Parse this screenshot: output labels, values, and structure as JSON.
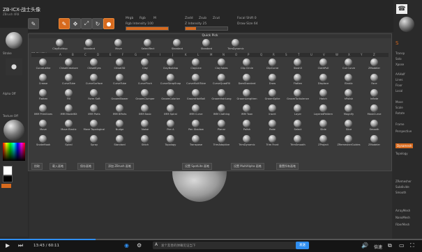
{
  "app": {
    "title": "ZB-ICX-战士头像",
    "subtitle": "ZBrush 4R8"
  },
  "top": {
    "labels": [
      "Mrgb",
      "Rgb",
      "M",
      "Zadd",
      "Zsub",
      "Zcut",
      "Rgb Intensity 100",
      "Z Intensity 25",
      "Focal Shift 0",
      "Draw Size 64"
    ],
    "rgb_intensity": 100,
    "z_intensity": 25
  },
  "quickpick": {
    "title": "Quick Pick",
    "items": [
      "ClayBuildup",
      "Standard",
      "Move",
      "SelectRect",
      "Standard",
      "Standard",
      "TrimDynamic"
    ]
  },
  "brush_section": {
    "title": "3D 雕刻画笔",
    "alphabet": [
      "A",
      "B",
      "C",
      "D",
      "E",
      "F",
      "G",
      "H",
      "I",
      "J",
      "K",
      "L",
      "M",
      "N",
      "O",
      "P",
      "Q",
      "R",
      "S",
      "T",
      "U",
      "V",
      "W",
      "X",
      "Y",
      "Z"
    ]
  },
  "brushes": [
    [
      "CurveLathe",
      "ChiselCreature",
      "ChiselEyes",
      "Chisel3D",
      "Clay",
      "ClayBuildup",
      "ClayLine",
      "ClayTubes",
      "Clip Circle",
      "ClipCurve",
      "Slash3",
      "ClothPull",
      "Cut Curve",
      "ZModeler"
    ],
    [
      "Crease",
      "CurveTube",
      "CurveSurface",
      "CurveTube",
      "CurvePinch",
      "CurveStrapSnap",
      "CurveMultiTube",
      "CurveQuadFill",
      "DamStandard",
      "Draw",
      "Flatten",
      "Displace",
      "Elastic",
      "Face"
    ],
    [
      "Flatten",
      "Fill",
      "Form Soft",
      "GroomBlower",
      "GroomClumper",
      "GroomColorize",
      "GroomHairBall",
      "GroomHairLong",
      "GroomLengthen",
      "GroomSpike",
      "GroomTurbulence",
      "Hatch",
      "hPolish",
      "Inflate"
    ],
    [
      "IMM Primitives",
      "IMM ModelKit",
      "IMM Parts",
      "IMM BParts",
      "IMM Basic",
      "IMM Spiral",
      "IMM Curve",
      "IMM Clothing",
      "IMM Toon",
      "Insert",
      "Layer",
      "LayeredPattern",
      "Magnify",
      "MaskCurve"
    ],
    [
      "Move",
      "Move Elastic",
      "Move Topological",
      "Nudge",
      "Noise",
      "Pen A",
      "Pen Shadow",
      "Planar",
      "Polish",
      "Rake",
      "Select",
      "Slide",
      "Slice",
      "Smooth"
    ],
    [
      "SnakeHook",
      "Spiral",
      "Spray",
      "Standard",
      "Stitch",
      "Topology",
      "Transpose",
      "TrimAdaptive",
      "TrimDynamic",
      "Trim Front",
      "TrimSmooth",
      "ZProject",
      "ZRemesherGuides",
      "ZModeler"
    ]
  ],
  "bottom_buttons": [
    "拾取",
    "载入画笔",
    "保存画笔",
    "添加 ZBrush 画笔",
    "设置 SpotLite 画笔",
    "设置 MultiAlpha 画笔",
    "重置所有画笔"
  ],
  "left_panel": [
    "Stroke",
    "Alpha Off",
    "Texture Off",
    "Material",
    "Gradient",
    "Main",
    "Secondary",
    "Switch Color",
    "Alternate"
  ],
  "right_panel": [
    "Polyframe",
    "Dynamic",
    "Transp",
    "Solo",
    "Xpose",
    "AAHalf",
    "Lines",
    "Floor",
    "Local",
    "Move",
    "Scale",
    "Rotate",
    "Frame",
    "Perspective",
    "AAHalf",
    "ZRemesher",
    "Subdivide",
    "Smooth",
    "Dynamesh",
    "Topology",
    "ArrayMesh",
    "NanoMesh",
    "FiberMesh"
  ],
  "video": {
    "time": "13:43 / 60:11",
    "progress": 0.227,
    "danmu_placeholder": "发个友善的弹幕见证当下",
    "send": "发送",
    "extra": [
      "倍速",
      "自动"
    ]
  },
  "colors": {
    "accent": "#d76a1e",
    "bili_blue": "#2f8ef0"
  }
}
